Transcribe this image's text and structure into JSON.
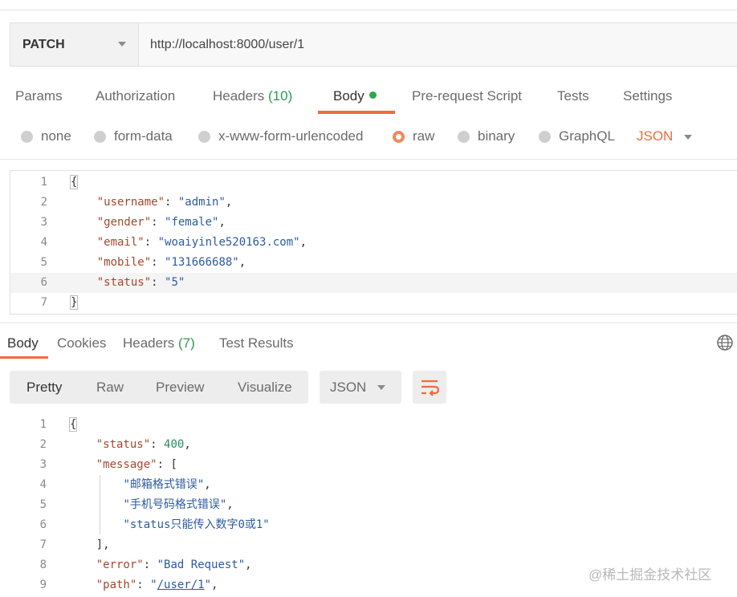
{
  "request": {
    "method": "PATCH",
    "url": "http://localhost:8000/user/1"
  },
  "request_tabs": {
    "params": "Params",
    "authorization": "Authorization",
    "headers": "Headers",
    "headers_count": "(10)",
    "body": "Body",
    "prerequest": "Pre-request Script",
    "tests": "Tests",
    "settings": "Settings"
  },
  "body_types": {
    "none": "none",
    "form_data": "form-data",
    "urlencoded": "x-www-form-urlencoded",
    "raw": "raw",
    "binary": "binary",
    "graphql": "GraphQL",
    "format": "JSON"
  },
  "request_body": {
    "line_numbers": [
      "1",
      "2",
      "3",
      "4",
      "5",
      "6",
      "7"
    ],
    "open_brace": "{",
    "close_brace": "}",
    "fields": [
      {
        "key": "\"username\"",
        "value": "\"admin\""
      },
      {
        "key": "\"gender\"",
        "value": "\"female\""
      },
      {
        "key": "\"email\"",
        "value": "\"woaiyinle520163.com\""
      },
      {
        "key": "\"mobile\"",
        "value": "\"131666688\""
      },
      {
        "key": "\"status\"",
        "value": "\"5\""
      }
    ]
  },
  "response_tabs": {
    "body": "Body",
    "cookies": "Cookies",
    "headers": "Headers",
    "headers_count": "(7)",
    "test_results": "Test Results"
  },
  "view_modes": {
    "pretty": "Pretty",
    "raw": "Raw",
    "preview": "Preview",
    "visualize": "Visualize",
    "format": "JSON"
  },
  "response_body": {
    "line_numbers": [
      "1",
      "2",
      "3",
      "4",
      "5",
      "6",
      "7",
      "8",
      "9"
    ],
    "open_brace": "{",
    "status_key": "\"status\"",
    "status_value": "400",
    "message_key": "\"message\"",
    "open_bracket": "[",
    "messages": [
      "\"邮箱格式错误\"",
      "\"手机号码格式错误\"",
      "\"status只能传入数字0或1\""
    ],
    "close_bracket": "],",
    "error_key": "\"error\"",
    "error_value": "\"Bad Request\"",
    "path_key": "\"path\"",
    "path_value": "/user/1"
  },
  "watermark": "@稀土掘金技术社区"
}
